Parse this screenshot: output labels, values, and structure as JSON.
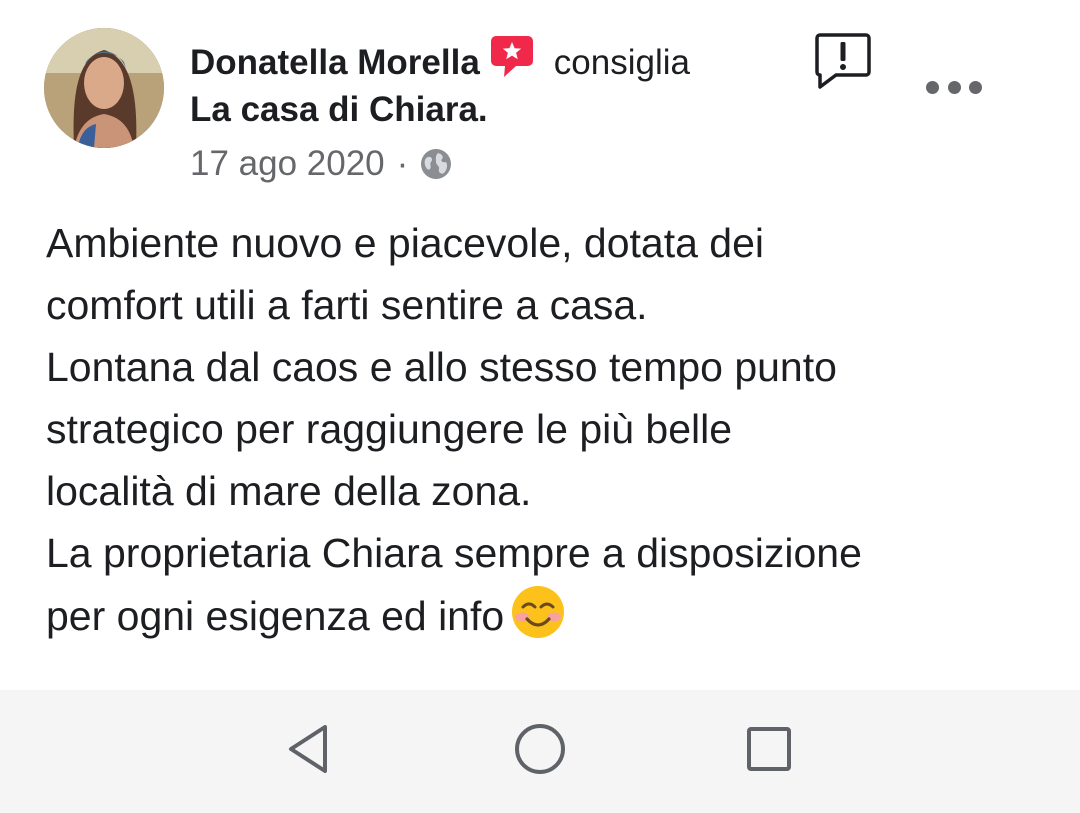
{
  "post": {
    "author": "Donatella Morella",
    "action": "consiglia",
    "page": "La casa di Chiara.",
    "date": "17 ago 2020",
    "separator": "·",
    "privacy_icon": "globe-icon",
    "body_lines": [
      "Ambiente nuovo e piacevole, dotata dei",
      "comfort utili a farti sentire a casa.",
      "Lontana dal caos e allo stesso tempo punto",
      "strategico per raggiungere le più belle",
      "località di mare della zona.",
      "La proprietaria Chiara sempre a disposizione",
      "per ogni esigenza ed info"
    ],
    "emoji": "smiling-face-icon"
  },
  "icons": {
    "recommend": "recommend-star-icon",
    "report": "report-icon",
    "more": "more-options-icon"
  },
  "navbar": {
    "buttons": [
      "back-icon",
      "home-icon",
      "recents-icon"
    ]
  },
  "colors": {
    "recommend_red": "#f0284a",
    "text": "#1c1e21",
    "secondary_text": "#65676b",
    "navbar_bg": "#f5f5f5"
  }
}
